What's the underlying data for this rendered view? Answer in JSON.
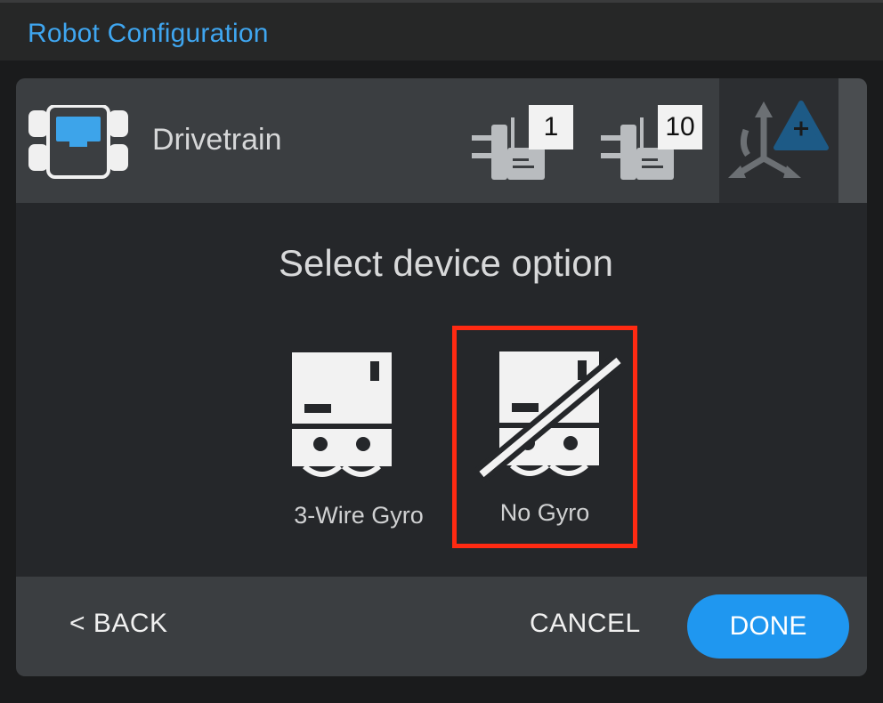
{
  "window": {
    "title": "Robot Configuration"
  },
  "device": {
    "name": "Drivetrain",
    "icon": "drivetrain-brain-icon"
  },
  "ports": [
    {
      "label": "1",
      "icon": "motor-port-icon"
    },
    {
      "label": "10",
      "icon": "motor-port-icon"
    }
  ],
  "sensor_tab": {
    "icon": "gyro-add-icon"
  },
  "prompt": "Select device option",
  "options": [
    {
      "label": "3-Wire Gyro",
      "icon": "gyro-icon",
      "selected": false
    },
    {
      "label": "No Gyro",
      "icon": "no-gyro-icon",
      "selected": true
    }
  ],
  "footer": {
    "back_label": "< BACK",
    "cancel_label": "CANCEL",
    "done_label": "DONE"
  },
  "colors": {
    "accent": "#1f97f0",
    "title": "#3fa6f0",
    "highlight": "#ff2a12"
  }
}
